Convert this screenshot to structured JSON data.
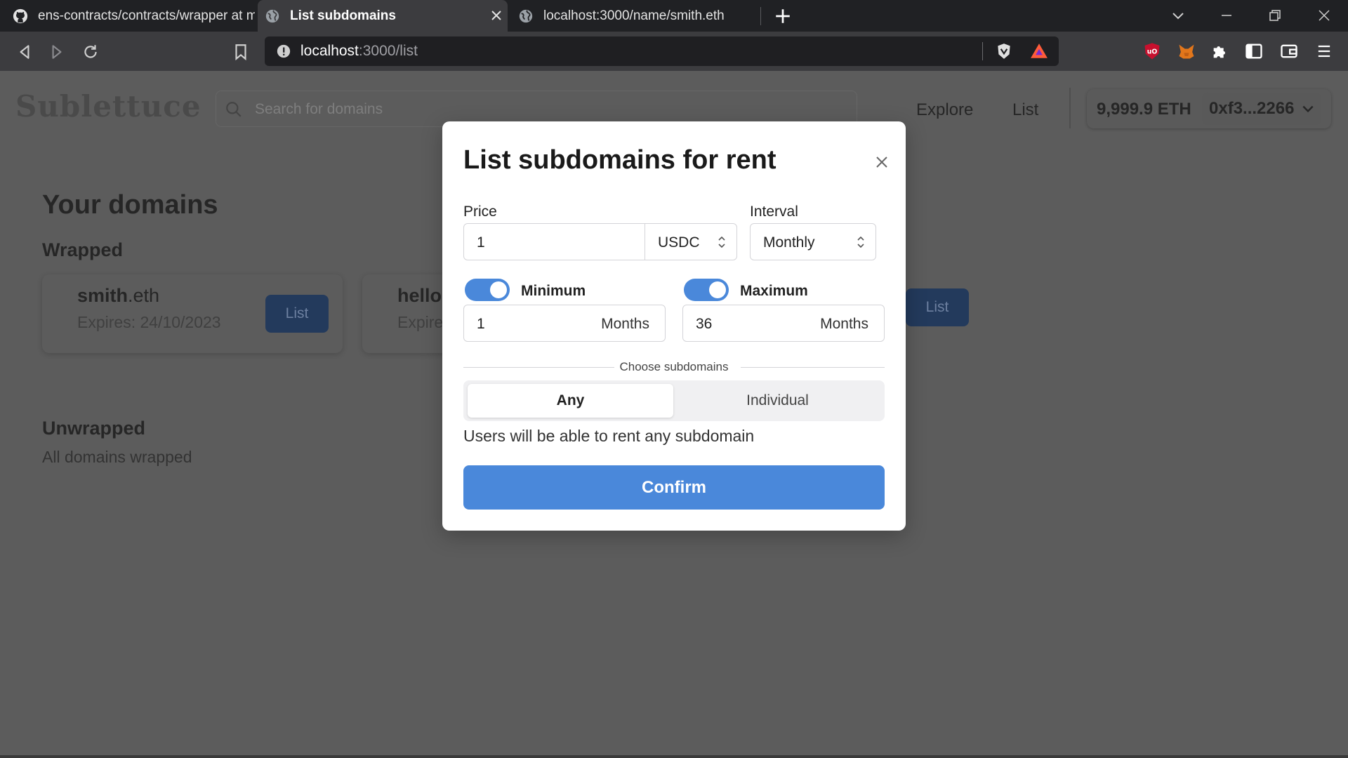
{
  "browser": {
    "tabs": [
      {
        "title": "ens-contracts/contracts/wrapper at m",
        "icon": "github-icon"
      },
      {
        "title": "List subdomains",
        "icon": "globe-icon",
        "active": true
      },
      {
        "title": "localhost:3000/name/smith.eth",
        "icon": "globe-icon"
      }
    ],
    "url_host": "localhost",
    "url_path": ":3000/list"
  },
  "header": {
    "logo": "Sublettuce",
    "search_placeholder": "Search for domains",
    "nav": [
      "Explore",
      "List"
    ],
    "balance": "9,999.9 ETH",
    "address": "0xf3...2266"
  },
  "main": {
    "title": "Your domains",
    "wrapped_heading": "Wrapped",
    "cards": [
      {
        "name_bold": "smith",
        "name_tld": ".eth",
        "expires": "Expires: 24/10/2023",
        "button": "List"
      },
      {
        "name_bold": "hello",
        "expires": "Expire",
        "button": "List"
      }
    ],
    "unwrapped_heading": "Unwrapped",
    "unwrapped_text": "All domains wrapped"
  },
  "modal": {
    "title": "List subdomains for rent",
    "price_label": "Price",
    "price_value": "1",
    "currency": "USDC",
    "interval_label": "Interval",
    "interval_value": "Monthly",
    "minimum_label": "Minimum",
    "minimum_value": "1",
    "minimum_unit": "Months",
    "maximum_label": "Maximum",
    "maximum_value": "36",
    "maximum_unit": "Months",
    "choose_label": "Choose subdomains",
    "segments": [
      "Any",
      "Individual"
    ],
    "helper": "Users will be able to rent any subdomain",
    "confirm": "Confirm"
  },
  "colors": {
    "accent": "#4a88da",
    "list_button_dimmed": "#233a5c",
    "overlay_background": "#5c5c5c"
  }
}
